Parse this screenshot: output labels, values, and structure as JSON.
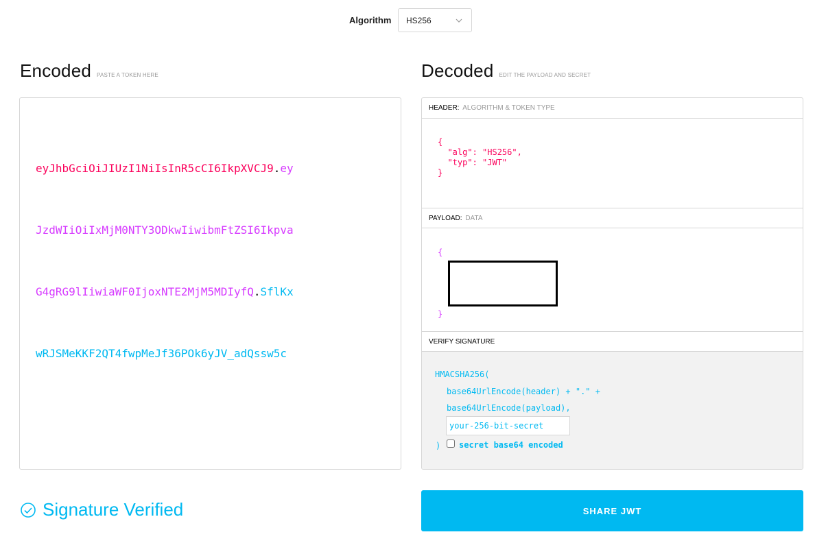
{
  "algorithm": {
    "label": "Algorithm",
    "selected": "HS256"
  },
  "encoded": {
    "title": "Encoded",
    "subtitle": "PASTE A TOKEN HERE",
    "token_header": "eyJhbGciOiJIUzI1NiIsInR5cCI6IkpXVCJ9",
    "token_payload": "eyJzdWIiOiIxMjM0NTY3ODkwIiwibmFtZSI6IkpvaG4gRG9lIiwiaWF0IjoxNTE2MjM5MDIyfQ",
    "token_signature": "SflKxwRJSMeKKF2QT4fwpMeJf36POk6yJV_adQssw5c",
    "lines": [
      [
        {
          "part": "header",
          "text": "eyJhbGciOiJIUzI1NiIsInR5cCI6IkpXVCJ9"
        },
        {
          "part": "dot",
          "text": "."
        },
        {
          "part": "payload",
          "text": "ey"
        }
      ],
      [
        {
          "part": "payload",
          "text": "JzdWIiOiIxMjM0NTY3ODkwIiwibmFtZSI6Ikpva"
        }
      ],
      [
        {
          "part": "payload",
          "text": "G4gRG9lIiwiaWF0IjoxNTE2MjM5MDIyfQ"
        },
        {
          "part": "dot",
          "text": "."
        },
        {
          "part": "sig",
          "text": "SflKx"
        }
      ],
      [
        {
          "part": "sig",
          "text": "wRJSMeKKF2QT4fwpMeJf36POk6yJV_adQssw5c"
        }
      ]
    ]
  },
  "decoded": {
    "title": "Decoded",
    "subtitle": "EDIT THE PAYLOAD AND SECRET",
    "header": {
      "label": "HEADER:",
      "label_muted": "ALGORITHM & TOKEN TYPE",
      "code": "{\n  \"alg\": \"HS256\",\n  \"typ\": \"JWT\"\n}"
    },
    "payload": {
      "label": "PAYLOAD:",
      "label_muted": "DATA",
      "code": "{\n\n\n\n\n\n}"
    },
    "verify": {
      "label": "VERIFY SIGNATURE",
      "func": "HMACSHA256(",
      "line1": "base64UrlEncode(header) + \".\" +",
      "line2": "base64UrlEncode(payload),",
      "secret_value": "your-256-bit-secret",
      "close": ")",
      "checkbox_label": "secret base64 encoded",
      "checkbox_checked": false
    }
  },
  "status": {
    "text": "Signature Verified",
    "icon": "check-circle-icon",
    "color": "#00b9f1"
  },
  "share_button": {
    "label": "SHARE JWT",
    "color": "#00b9f1"
  },
  "colors": {
    "header": "#fb015b",
    "payload": "#d63aff",
    "signature": "#00b9f1"
  }
}
